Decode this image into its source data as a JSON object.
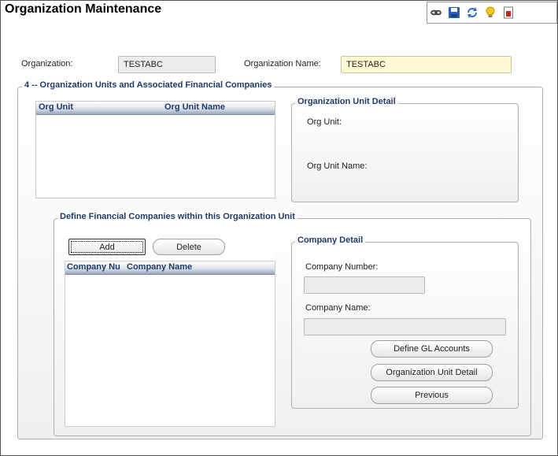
{
  "page": {
    "title": "Organization Maintenance"
  },
  "toolbar": {
    "icons": [
      "link-icon",
      "save-icon",
      "refresh-icon",
      "lightbulb-icon",
      "report-icon"
    ]
  },
  "header": {
    "org_label": "Organization:",
    "org_value": "TESTABC",
    "org_name_label": "Organization Name:",
    "org_name_value": "TESTABC"
  },
  "units_section": {
    "legend": "4 -- Organization Units and Associated Financial Companies",
    "grid_columns": [
      "Org Unit",
      "Org Unit Name"
    ],
    "rows": []
  },
  "unit_detail": {
    "legend": "Organization Unit Detail",
    "org_unit_label": "Org Unit:",
    "org_unit_name_label": "Org Unit Name:"
  },
  "companies_section": {
    "legend": "Define Financial Companies within this Organization Unit",
    "add_label": "Add",
    "delete_label": "Delete",
    "grid_columns": [
      "Company Nu",
      "Company Name"
    ],
    "rows": []
  },
  "company_detail": {
    "legend": "Company Detail",
    "number_label": "Company Number:",
    "number_value": "",
    "name_label": "Company Name:",
    "name_value": "",
    "define_gl_label": "Define GL Accounts",
    "org_unit_detail_label": "Organization Unit Detail",
    "previous_label": "Previous"
  }
}
